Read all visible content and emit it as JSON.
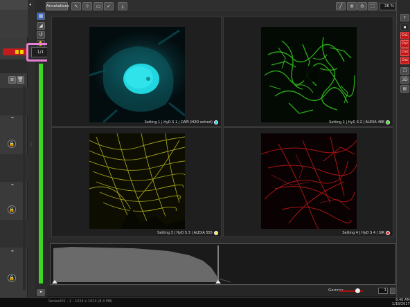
{
  "toolbar": {
    "annotations_label": "Annotations",
    "zoom_value": "36 %"
  },
  "counter_value": "1/1",
  "panels": [
    {
      "label": "Setting 1 | HyD S 1 | DAPI (H2O solved)",
      "dot_color": "#22d3ee",
      "image_color": "cyan"
    },
    {
      "label": "Setting 2 | HyD S 2 | ALEXA 488",
      "dot_color": "#3ed624",
      "image_color": "green"
    },
    {
      "label": "Setting 3 | HyD S 3 | ALEXA 555",
      "dot_color": "#e8e84a",
      "image_color": "yellow"
    },
    {
      "label": "Setting 4 | HyD S 4 | SIR",
      "dot_color": "#e03030",
      "image_color": "red"
    }
  ],
  "channels": [
    "Ch1",
    "Ch2",
    "Ch3",
    "Ch4"
  ],
  "gamma": {
    "label": "Gamma",
    "value": "1"
  },
  "status_text": "Series001 - 1 - 1024 x 1024 (8.4 MB)",
  "clock": {
    "time": "9:40 AM",
    "date": "1/18/2017"
  }
}
